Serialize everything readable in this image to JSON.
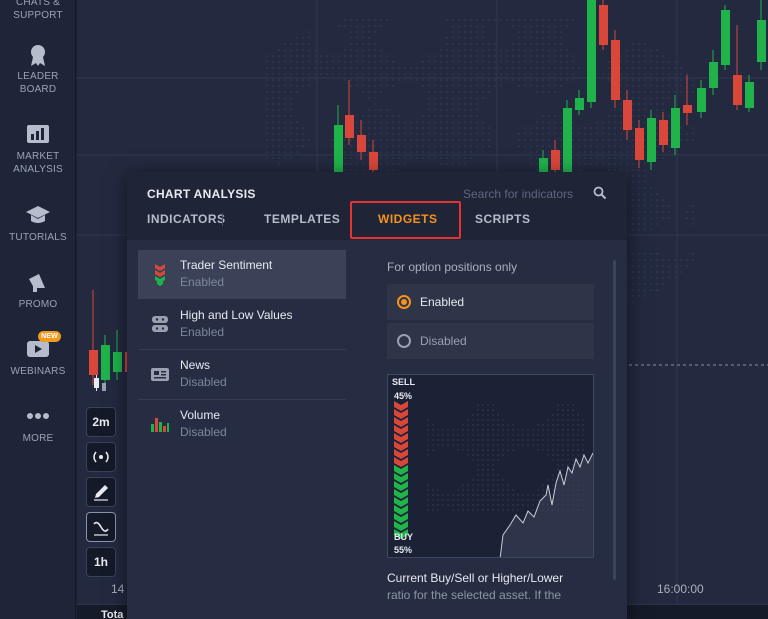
{
  "sidebar": {
    "items": [
      {
        "label1": "CHATS &",
        "label2": "SUPPORT",
        "icon": "chat-icon"
      },
      {
        "label1": "LEADER",
        "label2": "BOARD",
        "icon": "medal-icon"
      },
      {
        "label1": "MARKET",
        "label2": "ANALYSIS",
        "icon": "bar-chart-icon"
      },
      {
        "label1": "TUTORIALS",
        "label2": "",
        "icon": "graduation-cap-icon"
      },
      {
        "label1": "PROMO",
        "label2": "",
        "icon": "megaphone-icon"
      },
      {
        "label1": "WEBINARS",
        "label2": "",
        "icon": "play-icon",
        "badge": "NEW"
      },
      {
        "label1": "MORE",
        "label2": "",
        "icon": "more-dots-icon"
      }
    ]
  },
  "tools": {
    "timeframe": "2m",
    "expiry": "1h"
  },
  "chart": {
    "time_left": "14",
    "time_right": "16:00:00",
    "bottom_label": "Tota"
  },
  "panel": {
    "title": "CHART ANALYSIS",
    "search_placeholder": "Search for indicators",
    "tabs": [
      "INDICATORS",
      "TEMPLATES",
      "WIDGETS",
      "SCRIPTS"
    ],
    "active_tab": "WIDGETS",
    "widgets": [
      {
        "title": "Trader Sentiment",
        "status": "Enabled",
        "icon": "trader-sentiment-icon",
        "selected": true
      },
      {
        "title": "High and Low Values",
        "status": "Enabled",
        "icon": "high-low-icon",
        "selected": false
      },
      {
        "title": "News",
        "status": "Disabled",
        "icon": "news-icon",
        "selected": false
      },
      {
        "title": "Volume",
        "status": "Disabled",
        "icon": "volume-icon",
        "selected": false
      }
    ],
    "detail": {
      "note": "For option positions only",
      "options": [
        {
          "label": "Enabled",
          "checked": true
        },
        {
          "label": "Disabled",
          "checked": false
        }
      ],
      "preview": {
        "sell_label": "SELL",
        "sell_pct": "45%",
        "buy_label": "BUY",
        "buy_pct": "55%"
      },
      "desc_title": "Current Buy/Sell or Higher/Lower",
      "desc_body": "ratio for the selected asset. If the"
    }
  },
  "colors": {
    "accent": "#f5921e",
    "highlight": "#e3342f",
    "bull": "#1fb34a",
    "bear": "#d8473a"
  }
}
